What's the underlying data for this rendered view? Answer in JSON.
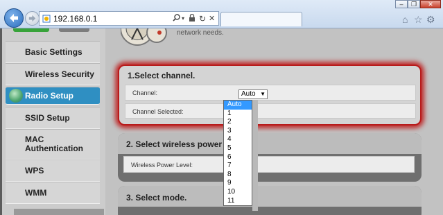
{
  "browser": {
    "url": "192.168.0.1",
    "address_icons": [
      "search-icon",
      "dropdown-arrow-icon",
      "lock-icon",
      "refresh-icon",
      "close-icon"
    ],
    "window_controls": [
      "minimize",
      "restore",
      "close"
    ],
    "window_glyphs": {
      "minimize": "–",
      "restore": "❐",
      "close": "✕"
    },
    "toolbar_icons": [
      "home-icon",
      "favorites-star-icon",
      "settings-gear-icon"
    ],
    "toolbar_glyphs": {
      "home": "⌂",
      "star": "☆",
      "gear": "⚙"
    }
  },
  "page": {
    "intro_text": "network needs.",
    "sidebar": {
      "items": [
        {
          "label": "Basic Settings",
          "active": false
        },
        {
          "label": "Wireless Security",
          "active": false
        },
        {
          "label": "Radio Setup",
          "active": true
        },
        {
          "label": "SSID Setup",
          "active": false
        },
        {
          "label": "MAC\nAuthentication",
          "active": false
        },
        {
          "label": "WPS",
          "active": false
        },
        {
          "label": "WMM",
          "active": false
        }
      ]
    },
    "sections": [
      {
        "title": "1.Select channel.",
        "rows": [
          {
            "label": "Channel:",
            "value": "Auto"
          },
          {
            "label": "Channel Selected:",
            "value": ""
          }
        ]
      },
      {
        "title": "2. Select wireless power le",
        "rows": [
          {
            "label": "Wireless Power Level:",
            "value": ""
          }
        ]
      },
      {
        "title": "3. Select mode.",
        "rows": []
      }
    ],
    "channel_dropdown": {
      "selected": "Auto",
      "options": [
        "Auto",
        "1",
        "2",
        "3",
        "4",
        "5",
        "6",
        "7",
        "8",
        "9",
        "10",
        "11"
      ]
    }
  },
  "colors": {
    "active_nav": "#2f8fc2",
    "highlight_border": "#b81b1b",
    "selected_option": "#3399ff"
  }
}
